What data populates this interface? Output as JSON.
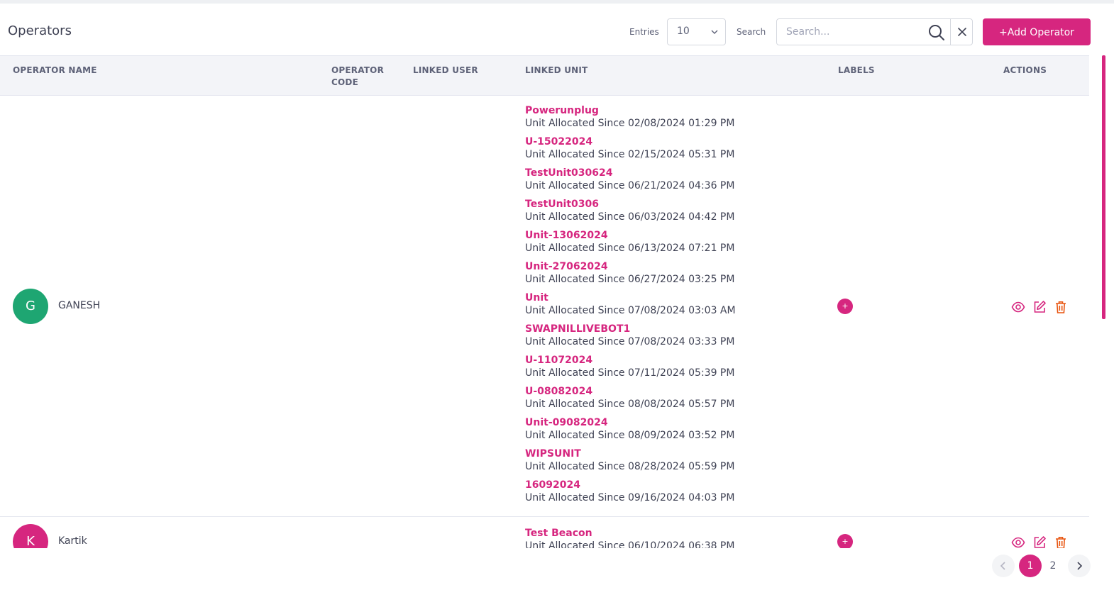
{
  "page": {
    "title": "Operators"
  },
  "toolbar": {
    "entries_label": "Entries",
    "entries_value": "10",
    "search_label": "Search",
    "search_placeholder": "Search...",
    "search_value": "",
    "add_label": "+Add Operator"
  },
  "table": {
    "columns": {
      "operator_name": "OPERATOR NAME",
      "operator_code_1": "OPERATOR",
      "operator_code_2": "CODE",
      "linked_user": "LINKED USER",
      "linked_unit": "LINKED UNIT",
      "labels": "LABELS",
      "actions": "ACTIONS"
    },
    "rows": [
      {
        "initial": "G",
        "name": "GANESH",
        "avatar_color": "#1ea672",
        "label_add": "+",
        "units": [
          {
            "name": "Powerunplug",
            "since": "Unit Allocated Since 02/08/2024 01:29 PM"
          },
          {
            "name": "U-15022024",
            "since": "Unit Allocated Since 02/15/2024 05:31 PM"
          },
          {
            "name": "TestUnit030624",
            "since": "Unit Allocated Since 06/21/2024 04:36 PM"
          },
          {
            "name": "TestUnit0306",
            "since": "Unit Allocated Since 06/03/2024 04:42 PM"
          },
          {
            "name": "Unit-13062024",
            "since": "Unit Allocated Since 06/13/2024 07:21 PM"
          },
          {
            "name": "Unit-27062024",
            "since": "Unit Allocated Since 06/27/2024 03:25 PM"
          },
          {
            "name": "Unit",
            "since": "Unit Allocated Since 07/08/2024 03:03 AM"
          },
          {
            "name": "SWAPNILLIVEBOT1",
            "since": "Unit Allocated Since 07/08/2024 03:33 PM"
          },
          {
            "name": "U-11072024",
            "since": "Unit Allocated Since 07/11/2024 05:39 PM"
          },
          {
            "name": "U-08082024",
            "since": "Unit Allocated Since 08/08/2024 05:57 PM"
          },
          {
            "name": "Unit-09082024",
            "since": "Unit Allocated Since 08/09/2024 03:52 PM"
          },
          {
            "name": "WIPSUNIT",
            "since": "Unit Allocated Since 08/28/2024 05:59 PM"
          },
          {
            "name": "16092024",
            "since": "Unit Allocated Since 09/16/2024 04:03 PM"
          }
        ]
      },
      {
        "initial": "K",
        "name": "Kartik",
        "avatar_color": "#d6267f",
        "label_add": "+",
        "units": [
          {
            "name": "Test Beacon",
            "since": "Unit Allocated Since 06/10/2024 06:38 PM"
          }
        ]
      }
    ]
  },
  "pagination": {
    "pages": [
      "1",
      "2"
    ],
    "current": "1",
    "prev_icon": "chevron-left-icon",
    "next_icon": "chevron-right-icon"
  },
  "colors": {
    "accent": "#d6267f",
    "delete": "#e8540f"
  }
}
